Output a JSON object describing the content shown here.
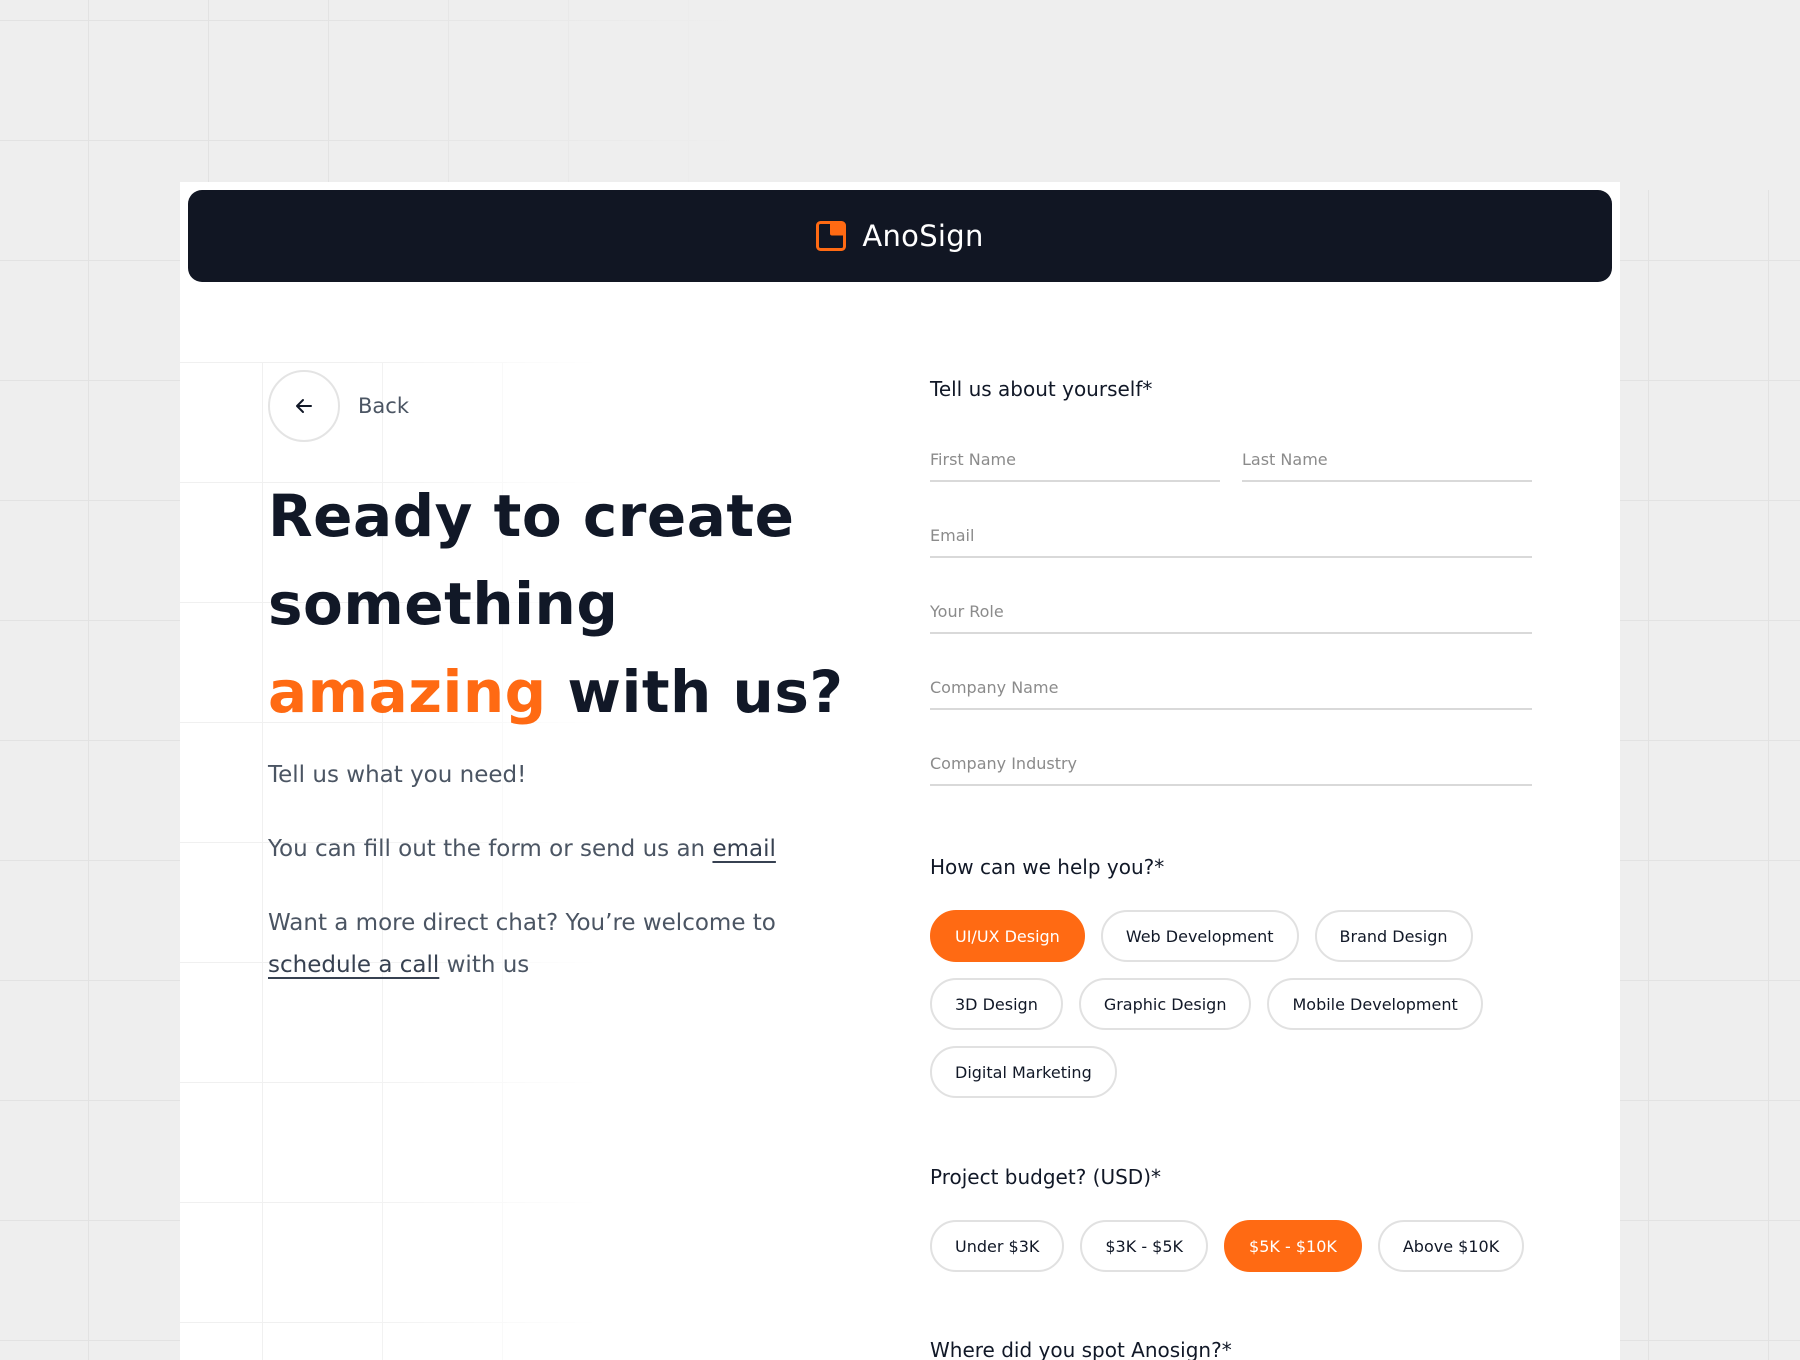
{
  "brand": {
    "name": "AnoSign",
    "accent_color": "#ff6a13",
    "navbar_color": "#111623"
  },
  "back": {
    "label": "Back",
    "icon": "arrow-left-icon"
  },
  "hero": {
    "line1": "Ready to create",
    "line2": "something",
    "accent_word": "amazing",
    "line3_rest": " with us?"
  },
  "copy": {
    "p1": "Tell us what you need!",
    "p2_text": "You can fill out the form or send us an ",
    "p2_link": "email",
    "p3_text": "Want a more direct chat? You’re welcome to ",
    "p3_link": "schedule a call",
    "p3_tail": " with us"
  },
  "form": {
    "about_title": "Tell us about yourself*",
    "fields": {
      "first_name": {
        "placeholder": "First Name",
        "value": ""
      },
      "last_name": {
        "placeholder": "Last Name",
        "value": ""
      },
      "email": {
        "placeholder": "Email",
        "value": ""
      },
      "role": {
        "placeholder": "Your Role",
        "value": ""
      },
      "company_name": {
        "placeholder": "Company Name",
        "value": ""
      },
      "company_industry": {
        "placeholder": "Company Industry",
        "value": ""
      }
    },
    "help_title": "How can we help you?*",
    "services": [
      {
        "label": "UI/UX Design",
        "selected": true
      },
      {
        "label": "Web Development",
        "selected": false
      },
      {
        "label": "Brand Design",
        "selected": false
      },
      {
        "label": "3D Design",
        "selected": false
      },
      {
        "label": "Graphic Design",
        "selected": false
      },
      {
        "label": "Mobile Development",
        "selected": false
      },
      {
        "label": "Digital Marketing",
        "selected": false
      }
    ],
    "budget_title": "Project budget? (USD)*",
    "budgets": [
      {
        "label": "Under $3K",
        "selected": false
      },
      {
        "label": "$3K - $5K",
        "selected": false
      },
      {
        "label": "$5K - $10K",
        "selected": true
      },
      {
        "label": "Above $10K",
        "selected": false
      }
    ],
    "source_title": "Where did you spot Anosign?*"
  }
}
